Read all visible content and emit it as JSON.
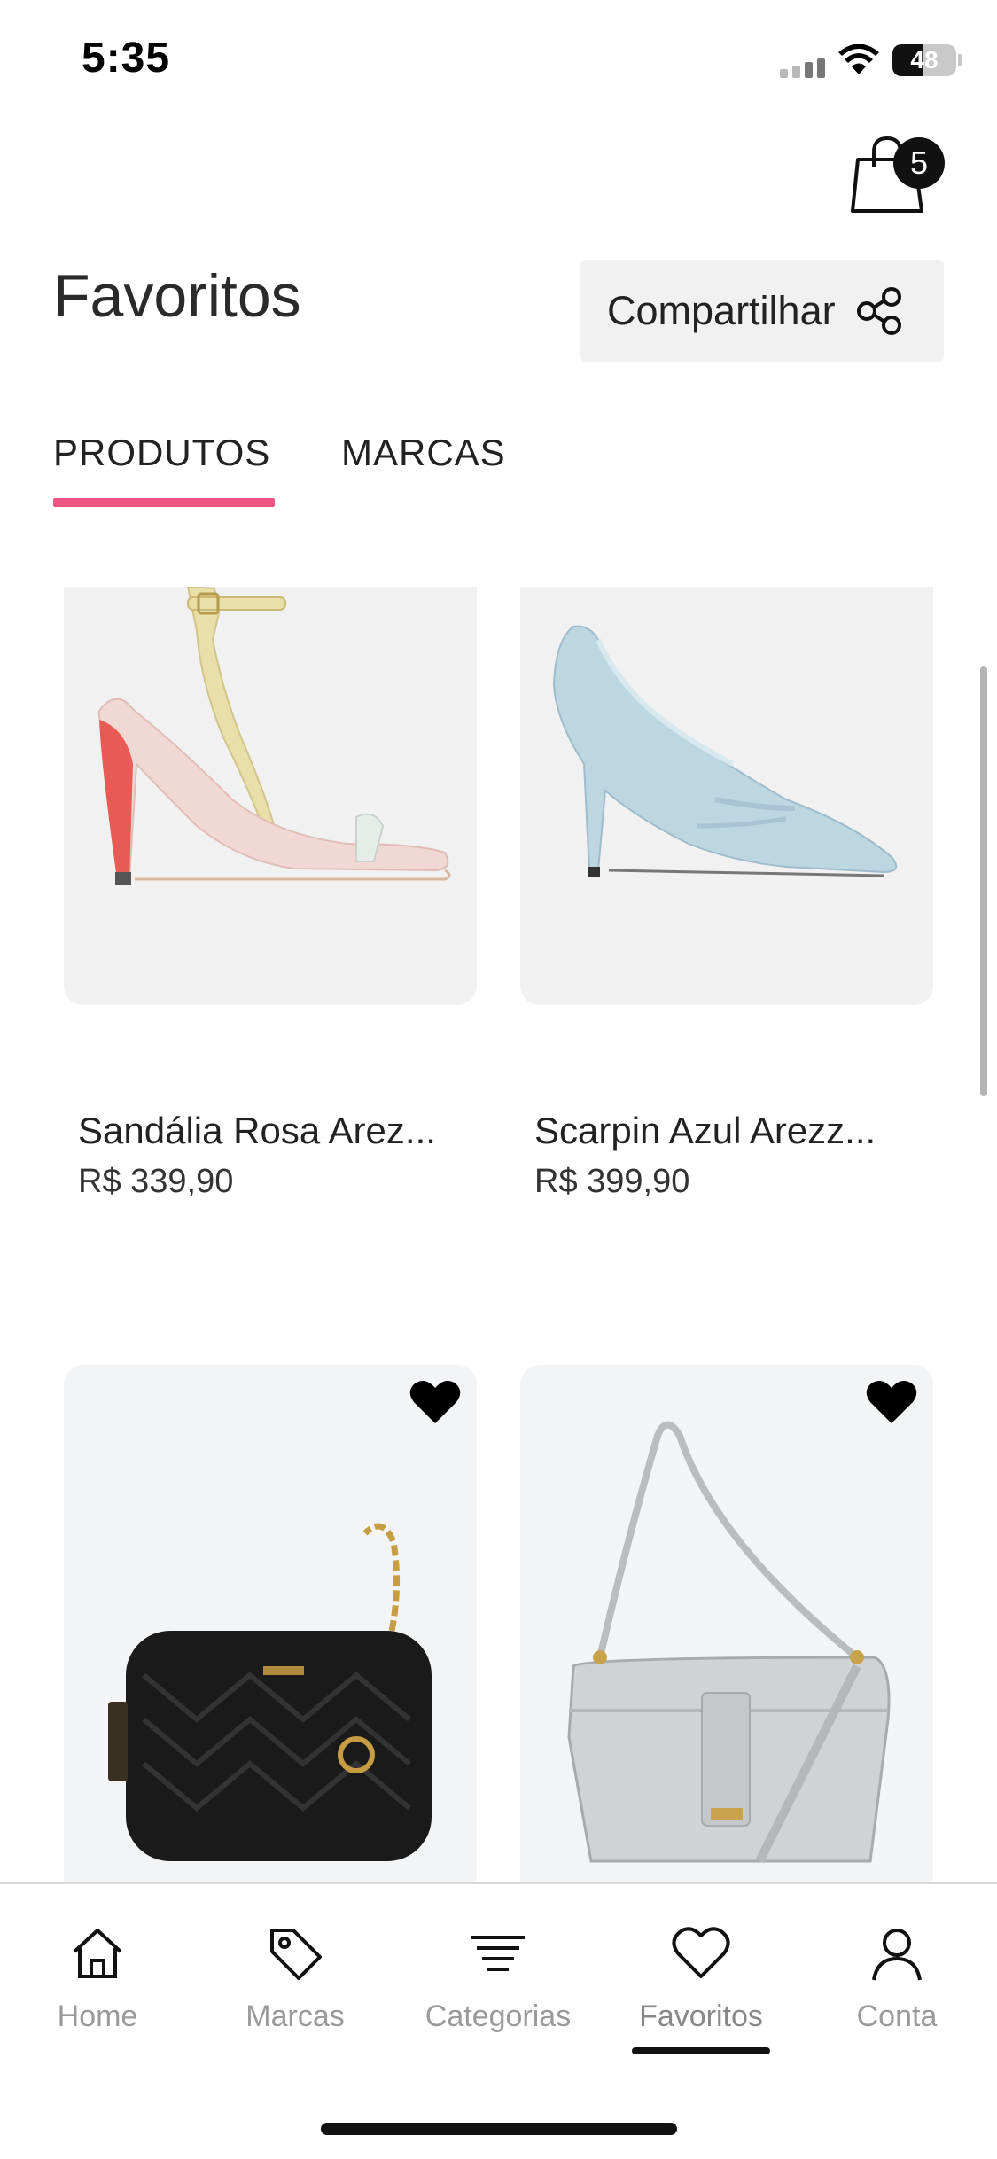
{
  "status_bar": {
    "time": "5:35",
    "battery": "48",
    "battery_level": 0.48
  },
  "cart": {
    "count": "5"
  },
  "header": {
    "title": "Favoritos",
    "share_label": "Compartilhar"
  },
  "tabs": [
    {
      "label": "PRODUTOS",
      "active": true
    },
    {
      "label": "MARCAS",
      "active": false
    }
  ],
  "products": [
    {
      "name": "Sandália Rosa Arez...",
      "price": "R$ 339,90",
      "favorite_icon": "none"
    },
    {
      "name": "Scarpin Azul Arezz...",
      "price": "R$ 399,90",
      "favorite_icon": "none"
    },
    {
      "name": "",
      "price": "",
      "favorite_icon": "heart-filled-icon"
    },
    {
      "name": "",
      "price": "",
      "favorite_icon": "heart-filled-icon"
    }
  ],
  "nav": [
    {
      "label": "Home",
      "icon": "home-icon"
    },
    {
      "label": "Marcas",
      "icon": "tag-icon"
    },
    {
      "label": "Categorias",
      "icon": "filter-lines-icon"
    },
    {
      "label": "Favoritos",
      "icon": "heart-icon",
      "active": true
    },
    {
      "label": "Conta",
      "icon": "user-icon"
    }
  ],
  "colors": {
    "accent": "#ee5580",
    "card_bg": "#f1f1f1",
    "text": "#222222"
  }
}
